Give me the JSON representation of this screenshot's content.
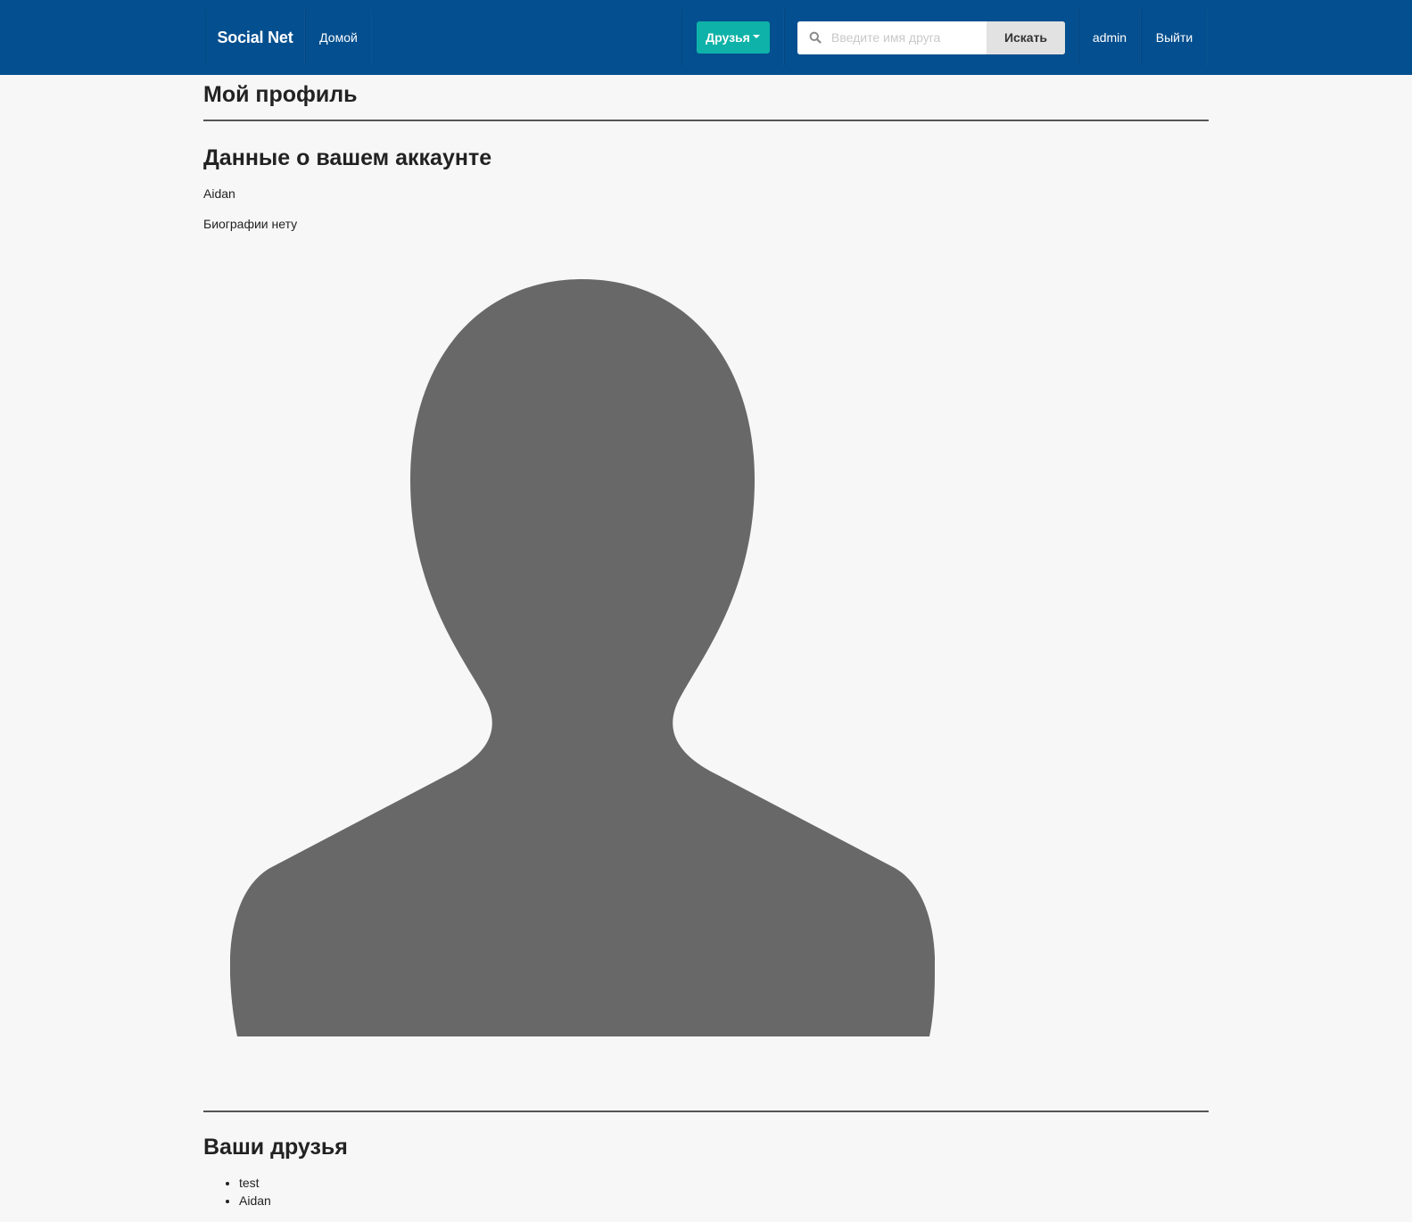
{
  "navbar": {
    "brand": "Social Net",
    "home_label": "Домой",
    "friends_label": "Друзья",
    "search": {
      "placeholder": "Введите имя друга",
      "value": "",
      "button_label": "Искать"
    },
    "user_label": "admin",
    "logout_label": "Выйти"
  },
  "main": {
    "page_title": "Мой профиль",
    "account_title": "Данные о вашем аккаунте",
    "username": "Aidan",
    "bio": "Биографии нету",
    "avatar_icon": "user-silhouette-icon",
    "friends_title": "Ваши друзья",
    "friends": [
      "test",
      "Aidan"
    ]
  },
  "colors": {
    "navbar_bg": "#044f8f",
    "accent": "#0fb2a8",
    "page_bg": "#f7f7f7",
    "avatar_fill": "#686868"
  }
}
